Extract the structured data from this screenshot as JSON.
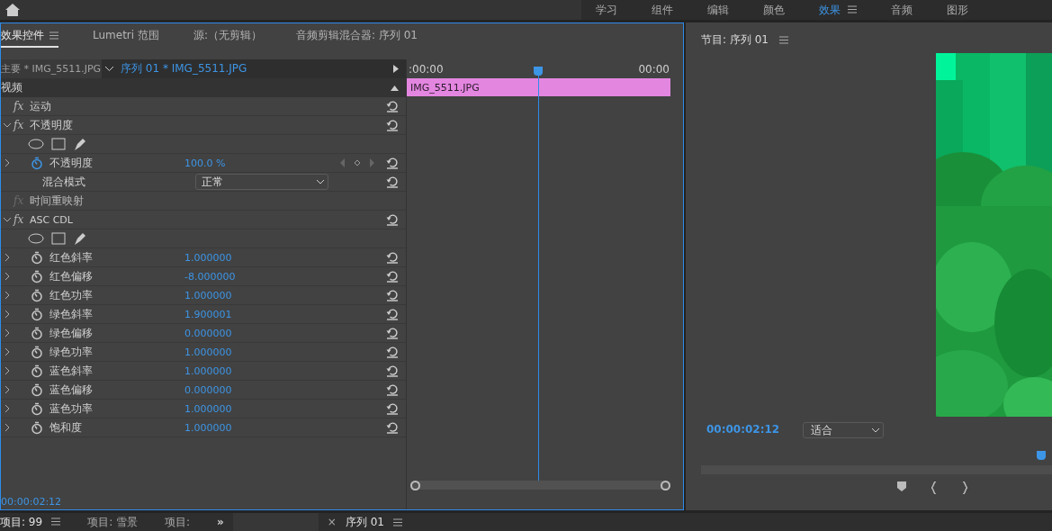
{
  "workspace_tabs": [
    {
      "label": "学习",
      "selected": false
    },
    {
      "label": "组件",
      "selected": false
    },
    {
      "label": "编辑",
      "selected": false
    },
    {
      "label": "颜色",
      "selected": false
    },
    {
      "label": "效果",
      "selected": true
    },
    {
      "label": "音频",
      "selected": false
    },
    {
      "label": "图形",
      "selected": false
    }
  ],
  "effect_panel": {
    "tabs": [
      {
        "label": "效果控件",
        "selected": true
      },
      {
        "label": "Lumetri 范围",
        "selected": false
      },
      {
        "label": "源:（无剪辑）",
        "selected": false
      },
      {
        "label": "音频剪辑混合器: 序列 01",
        "selected": false
      }
    ],
    "master_clip": "主要 * IMG_5511.JPG",
    "sequence_clip": "序列 01 * IMG_5511.JPG",
    "section": "视频",
    "rows": [
      {
        "kind": "effect",
        "badge": "fx",
        "name": "运动",
        "enabled": true
      },
      {
        "kind": "effect",
        "badge": "fx",
        "name": "不透明度",
        "enabled": true,
        "expanded": true
      },
      {
        "kind": "masks"
      },
      {
        "kind": "param",
        "name": "不透明度",
        "value": "100.0 %",
        "animated": true,
        "keyframes": true
      },
      {
        "kind": "dropdown",
        "name": "混合模式",
        "value": "正常"
      },
      {
        "kind": "effect",
        "badge": "fx",
        "name": "时间重映射",
        "enabled": false
      },
      {
        "kind": "effect",
        "badge": "fx",
        "name": "ASC CDL",
        "enabled": true,
        "expanded": true
      },
      {
        "kind": "masks"
      },
      {
        "kind": "param",
        "name": "红色斜率",
        "value": "1.000000",
        "animated": false
      },
      {
        "kind": "param",
        "name": "红色偏移",
        "value": "-8.000000",
        "animated": false
      },
      {
        "kind": "param",
        "name": "红色功率",
        "value": "1.000000",
        "animated": false
      },
      {
        "kind": "param",
        "name": "绿色斜率",
        "value": "1.900001",
        "animated": false
      },
      {
        "kind": "param",
        "name": "绿色偏移",
        "value": "0.000000",
        "animated": false
      },
      {
        "kind": "param",
        "name": "绿色功率",
        "value": "1.000000",
        "animated": false
      },
      {
        "kind": "param",
        "name": "蓝色斜率",
        "value": "1.000000",
        "animated": false
      },
      {
        "kind": "param",
        "name": "蓝色偏移",
        "value": "0.000000",
        "animated": false
      },
      {
        "kind": "param",
        "name": "蓝色功率",
        "value": "1.000000",
        "animated": false
      },
      {
        "kind": "param",
        "name": "饱和度",
        "value": "1.000000",
        "animated": false
      }
    ],
    "ruler_start": ":00:00",
    "ruler_end": "00:00",
    "clip": "IMG_5511.JPG",
    "playhead": {
      "level": 0.49
    },
    "timecode": "00:00:02:12"
  },
  "program_monitor": {
    "title": "节目: 序列 01",
    "timecode": "00:00:02:12",
    "zoom": "适合",
    "playhead": {
      "level": 0.97
    }
  },
  "bottom_tabs": [
    {
      "label": "项目: 99",
      "selected": true
    },
    {
      "label": "项目: 雪景",
      "selected": false
    },
    {
      "label": "项目:",
      "selected": false
    }
  ],
  "overflow": "»",
  "timeline_tab": {
    "close": "×",
    "label": "序列 01"
  }
}
